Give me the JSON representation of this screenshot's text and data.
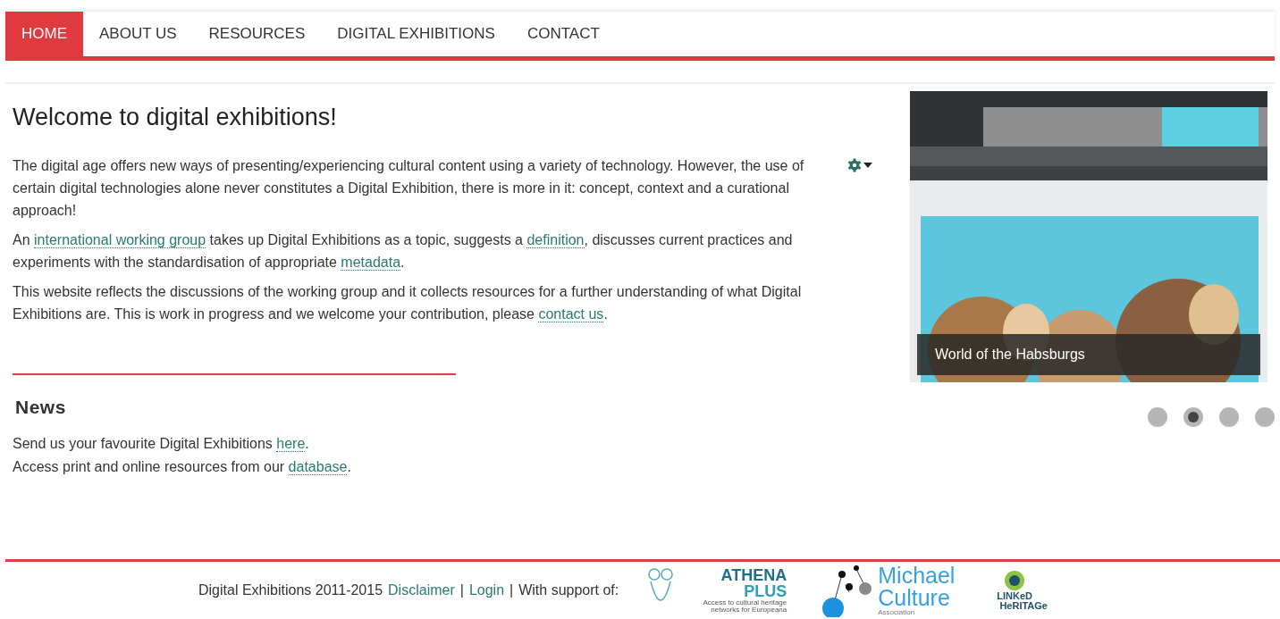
{
  "nav": [
    {
      "label": "HOME",
      "selected": true
    },
    {
      "label": "ABOUT US",
      "selected": false
    },
    {
      "label": "RESOURCES",
      "selected": false
    },
    {
      "label": "DIGITAL EXHIBITIONS",
      "selected": false
    },
    {
      "label": "CONTACT",
      "selected": false
    }
  ],
  "heading": "Welcome to digital exhibitions!",
  "paragraphs": [
    [
      {
        "kind": "text",
        "text": "The digital age offers new ways of presenting/experiencing cultural content using a variety of technology. However, the use of certain digital technologies alone never constitutes a Digital Exhibition, there is more in it: concept, context and a curational approach!"
      }
    ],
    [
      {
        "kind": "text",
        "text": "An "
      },
      {
        "kind": "link",
        "text": "international working group"
      },
      {
        "kind": "text",
        "text": " takes up Digital Exhibitions as a topic, suggests a "
      },
      {
        "kind": "link",
        "text": "definition"
      },
      {
        "kind": "text",
        "text": ", discusses current practices and experiments with the standardisation of appropriate "
      },
      {
        "kind": "link",
        "text": "metadata"
      },
      {
        "kind": "text",
        "text": "."
      }
    ],
    [
      {
        "kind": "text",
        "text": "This website reflects the discussions of the working group and it collects resources for a further understanding of what Digital Exhibitions are. This is work in progress and we welcome your contribution, please "
      },
      {
        "kind": "link",
        "text": "contact us"
      },
      {
        "kind": "text",
        "text": "."
      }
    ]
  ],
  "news": {
    "title": "News",
    "lines": [
      [
        {
          "kind": "text",
          "text": "Send us your favourite Digital Exhibitions "
        },
        {
          "kind": "link",
          "text": "here"
        },
        {
          "kind": "text",
          "text": "."
        }
      ],
      [
        {
          "kind": "text",
          "text": "Access print and online resources from our "
        },
        {
          "kind": "link",
          "text": "database"
        },
        {
          "kind": "text",
          "text": "."
        }
      ]
    ]
  },
  "slider": {
    "caption": "World of the Habsburgs",
    "slides": [
      {
        "selected": false
      },
      {
        "selected": true
      },
      {
        "selected": false
      },
      {
        "selected": false
      }
    ]
  },
  "footer": {
    "text": "Digital Exhibitions 2011-2015",
    "links": [
      "Disclaimer",
      "Login"
    ],
    "separator": "|",
    "support": "With support of:",
    "logos": {
      "athena": [
        "ATHENA",
        "PLUS",
        "Access to cultural heritage networks for Europeana"
      ],
      "michael": [
        "Michael",
        "Culture",
        "Association"
      ],
      "linked": [
        "LINKeD",
        "HeRITAGe"
      ]
    }
  }
}
